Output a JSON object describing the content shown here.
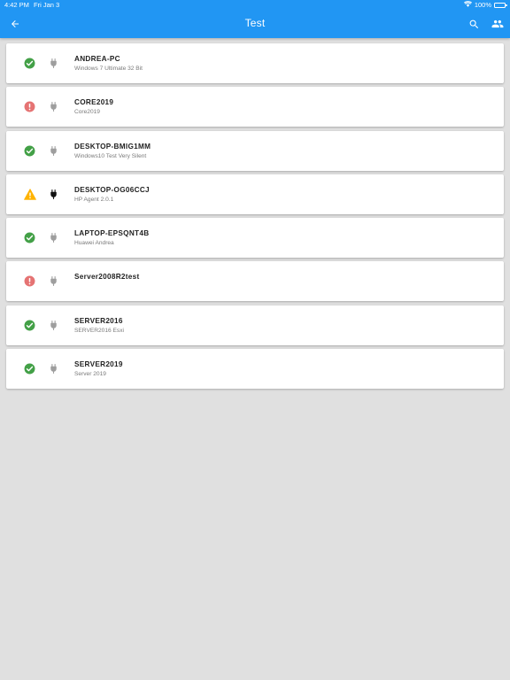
{
  "status_bar": {
    "time": "4:42 PM",
    "date": "Fri Jan 3",
    "battery": "100%"
  },
  "header": {
    "title": "Test",
    "icons": [
      "back-arrow-icon",
      "search-icon",
      "people-icon"
    ]
  },
  "colors": {
    "appbar": "#2196f3",
    "ok": "#43a047",
    "error": "#e57373",
    "warning": "#ffb300",
    "plug_inactive": "#9e9e9e",
    "plug_active": "#111111"
  },
  "devices": [
    {
      "name": "ANDREA-PC",
      "description": "Windows 7 Ultimate 32 Bit",
      "status": "ok",
      "plug": "inactive"
    },
    {
      "name": "CORE2019",
      "description": "Core2019",
      "status": "error",
      "plug": "inactive"
    },
    {
      "name": "DESKTOP-BMIG1MM",
      "description": "Windows10 Test Very Silent",
      "status": "ok",
      "plug": "inactive"
    },
    {
      "name": "DESKTOP-OG06CCJ",
      "description": "HP Agent 2.0.1",
      "status": "warning",
      "plug": "active"
    },
    {
      "name": "LAPTOP-EPSQNT4B",
      "description": "Huawei Andrea",
      "status": "ok",
      "plug": "inactive"
    },
    {
      "name": "Server2008R2test",
      "description": "",
      "status": "error",
      "plug": "inactive"
    },
    {
      "name": "SERVER2016",
      "description": "SERVER2016 Esxi",
      "status": "ok",
      "plug": "inactive"
    },
    {
      "name": "SERVER2019",
      "description": "Server 2019",
      "status": "ok",
      "plug": "inactive"
    }
  ]
}
